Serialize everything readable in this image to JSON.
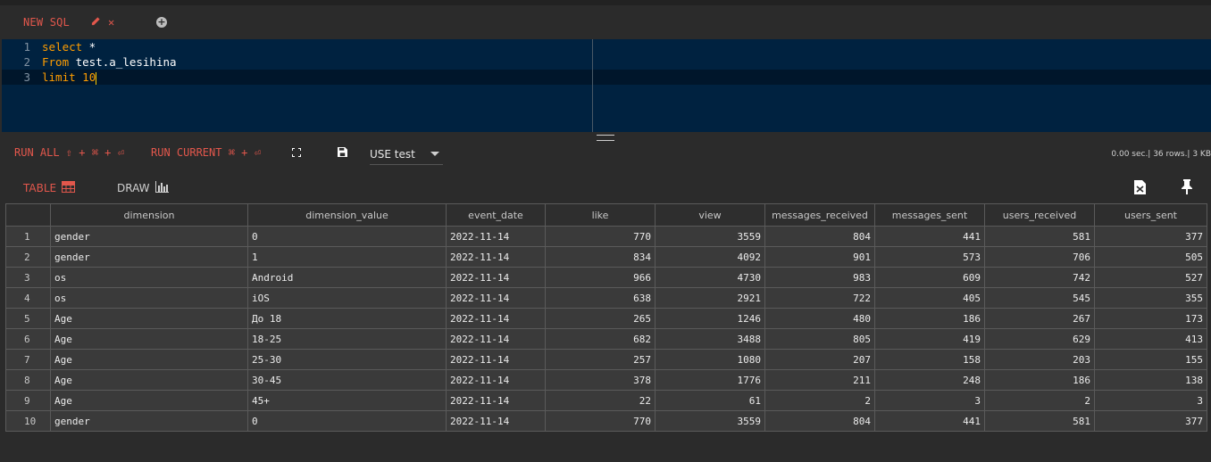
{
  "tab": {
    "label": "NEW SQL"
  },
  "editor": {
    "lines": [
      {
        "num": "1",
        "kw": "select",
        "rest": " *"
      },
      {
        "num": "2",
        "kw": "From",
        "rest": " test.a_lesihina"
      },
      {
        "num": "3",
        "kw": "limit",
        "rest": " 10"
      }
    ]
  },
  "toolbar": {
    "run_all_label": "RUN ALL ⇧ + ⌘ + ⏎",
    "run_current_label": "RUN CURRENT ⌘ + ⏎",
    "database_select": "USE test",
    "status": "0.00 sec.| 36 rows.| 3 KB"
  },
  "view": {
    "table_label": "TABLE",
    "draw_label": "DRAW"
  },
  "icons": {
    "edit": "pencil-icon",
    "close": "close-icon",
    "add": "plus-circle-icon",
    "expand": "expand-icon",
    "save": "floppy-disk-icon",
    "table": "table-grid-icon",
    "draw": "bar-chart-icon",
    "export": "export-file-icon",
    "pin": "pin-icon"
  },
  "colors": {
    "accent": "#e2574c",
    "editor_bg": "#002240",
    "keyword": "#ff9d00"
  },
  "table": {
    "columns": [
      "",
      "dimension",
      "dimension_value",
      "event_date",
      "like",
      "view",
      "messages_received",
      "messages_sent",
      "users_received",
      "users_sent"
    ],
    "rows": [
      [
        "1",
        "gender",
        "0",
        "2022-11-14",
        "770",
        "3559",
        "804",
        "441",
        "581",
        "377"
      ],
      [
        "2",
        "gender",
        "1",
        "2022-11-14",
        "834",
        "4092",
        "901",
        "573",
        "706",
        "505"
      ],
      [
        "3",
        "os",
        "Android",
        "2022-11-14",
        "966",
        "4730",
        "983",
        "609",
        "742",
        "527"
      ],
      [
        "4",
        "os",
        "iOS",
        "2022-11-14",
        "638",
        "2921",
        "722",
        "405",
        "545",
        "355"
      ],
      [
        "5",
        "Age",
        "До 18",
        "2022-11-14",
        "265",
        "1246",
        "480",
        "186",
        "267",
        "173"
      ],
      [
        "6",
        "Age",
        "18-25",
        "2022-11-14",
        "682",
        "3488",
        "805",
        "419",
        "629",
        "413"
      ],
      [
        "7",
        "Age",
        "25-30",
        "2022-11-14",
        "257",
        "1080",
        "207",
        "158",
        "203",
        "155"
      ],
      [
        "8",
        "Age",
        "30-45",
        "2022-11-14",
        "378",
        "1776",
        "211",
        "248",
        "186",
        "138"
      ],
      [
        "9",
        "Age",
        "45+",
        "2022-11-14",
        "22",
        "61",
        "2",
        "3",
        "2",
        "3"
      ],
      [
        "10",
        "gender",
        "0",
        "2022-11-14",
        "770",
        "3559",
        "804",
        "441",
        "581",
        "377"
      ]
    ]
  }
}
